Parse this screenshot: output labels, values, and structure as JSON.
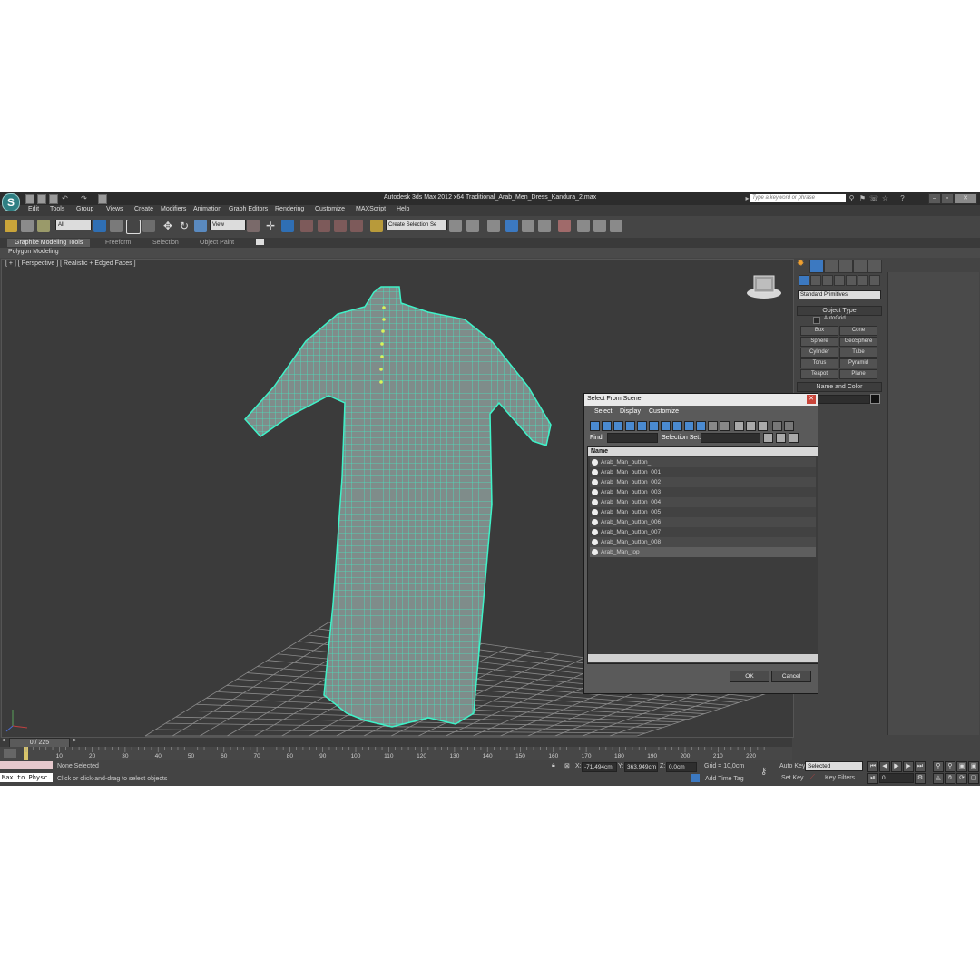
{
  "title_bar": {
    "app_title": "Autodesk 3ds Max  2012 x64     Traditional_Arab_Men_Dress_Kandura_2.max",
    "search_placeholder": "Type a keyword or phrase"
  },
  "menu": [
    "Edit",
    "Tools",
    "Group",
    "Views",
    "Create",
    "Modifiers",
    "Animation",
    "Graph Editors",
    "Rendering",
    "Customize",
    "MAXScript",
    "Help"
  ],
  "toolbar": {
    "selection_filter": "All",
    "coord_system": "View",
    "named_selection_placeholder": "Create Selection Se"
  },
  "ribbon": {
    "tabs": [
      "Graphite Modeling Tools",
      "Freeform",
      "Selection",
      "Object Paint"
    ],
    "sub_tab": "Polygon Modeling"
  },
  "viewport": {
    "label": "[ + ] [ Perspective ] [ Realistic + Edged Faces ]"
  },
  "command_panel": {
    "category_dropdown": "Standard Primitives",
    "object_type_title": "Object Type",
    "autogrid_label": "AutoGrid",
    "primitive_buttons": [
      "Box",
      "Cone",
      "Sphere",
      "GeoSphere",
      "Cylinder",
      "Tube",
      "Torus",
      "Pyramid",
      "Teapot",
      "Plane"
    ],
    "name_color_title": "Name and Color"
  },
  "dialog": {
    "title": "Select From Scene",
    "menu": [
      "Select",
      "Display",
      "Customize"
    ],
    "find_label": "Find:",
    "selection_set_label": "Selection Set:",
    "column_header": "Name",
    "items": [
      "Arab_Man_button_",
      "Arab_Man_button_001",
      "Arab_Man_button_002",
      "Arab_Man_button_003",
      "Arab_Man_button_004",
      "Arab_Man_button_005",
      "Arab_Man_button_006",
      "Arab_Man_button_007",
      "Arab_Man_button_008",
      "Arab_Man_top"
    ],
    "ok_label": "OK",
    "cancel_label": "Cancel"
  },
  "timeline": {
    "frame_counter": "0 / 225",
    "ticks": [
      "0",
      "10",
      "20",
      "30",
      "40",
      "50",
      "60",
      "70",
      "80",
      "90",
      "100",
      "110",
      "120",
      "130",
      "140",
      "150",
      "160",
      "170",
      "180",
      "190",
      "200",
      "210",
      "220"
    ]
  },
  "status": {
    "maxscript_listener": "Max to Physc.",
    "selection_status": "None Selected",
    "prompt": "Click or click-and-drag to select objects",
    "x_label": "X:",
    "x_value": "-71,494cm",
    "y_label": "Y:",
    "y_value": "363,949cm",
    "z_label": "Z:",
    "z_value": "0,0cm",
    "grid": "Grid = 10,0cm",
    "add_time_tag": "Add Time Tag",
    "auto_key": "Auto Key",
    "set_key": "Set Key",
    "key_mode": "Selected",
    "key_filters": "Key Filters...",
    "current_frame": "0"
  },
  "colors": {
    "wireframe": "#3ff2c8",
    "background": "#444444",
    "viewport": "#3b3b3b"
  }
}
